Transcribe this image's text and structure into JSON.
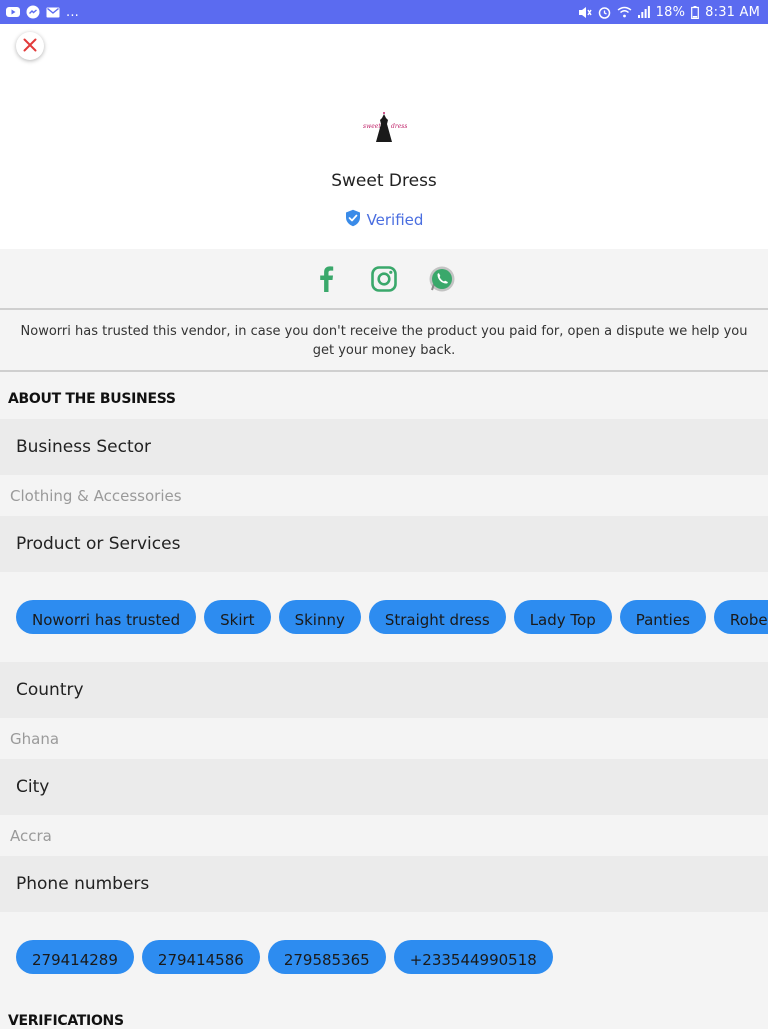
{
  "status_bar": {
    "left_icons": [
      "youtube-icon",
      "messenger-icon",
      "gmail-icon"
    ],
    "more": "...",
    "right_icons": [
      "mute-icon",
      "alarm-icon",
      "wifi-icon",
      "signal-icon"
    ],
    "battery": "18%",
    "time": "8:31 AM",
    "bg_color": "#5b6bf0"
  },
  "header": {
    "close_icon": "close-icon",
    "logo_icon": "dress-logo-icon",
    "store_name": "Sweet Dress",
    "verified_label": "Verified",
    "verified_icon": "shield-check-icon",
    "accent_color": "#4a6ee0"
  },
  "social": {
    "items": [
      "facebook-icon",
      "instagram-icon",
      "whatsapp-icon"
    ],
    "color": "#3aa86b"
  },
  "notice": {
    "text": "Noworri has trusted this vendor, in case you don't receive the product you paid for, open a dispute we help you get your money back."
  },
  "about": {
    "heading": "ABOUT THE BUSINESS",
    "business_sector_label": "Business Sector",
    "business_sector_value": "Clothing & Accessories",
    "products_label": "Product or Services",
    "products": [
      "Noworri has trusted",
      "Skirt",
      "Skinny",
      "Straight dress",
      "Lady Top",
      "Panties",
      "Robe"
    ],
    "country_label": "Country",
    "country_value": "Ghana",
    "city_label": "City",
    "city_value": "Accra",
    "phones_label": "Phone numbers",
    "phones": [
      "279414289",
      "279414586",
      "279585365",
      "+233544990518"
    ],
    "chip_color": "#2d8cf0"
  },
  "verifications": {
    "heading": "VERIFICATIONS"
  }
}
